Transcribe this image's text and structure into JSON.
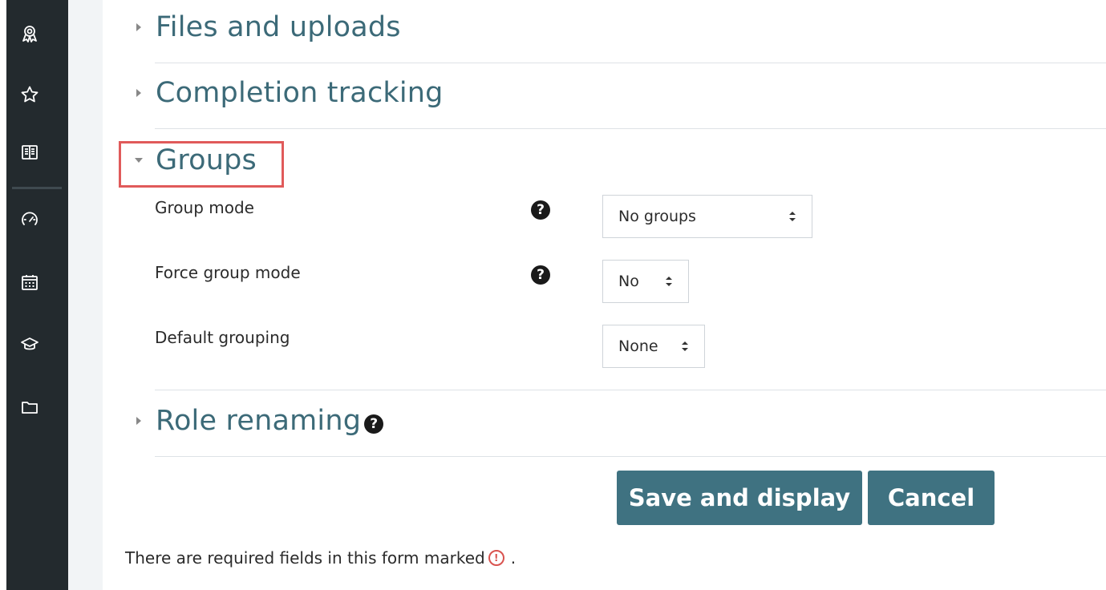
{
  "nav_rail": {
    "icons": [
      "badge-icon",
      "star-icon",
      "book-icon",
      "dashboard-icon",
      "calendar-icon",
      "graduation-cap-icon",
      "folder-icon"
    ]
  },
  "sections": {
    "files": {
      "title": "Files and uploads",
      "expanded": false
    },
    "completion": {
      "title": "Completion tracking",
      "expanded": false
    },
    "groups": {
      "title": "Groups",
      "expanded": true
    },
    "roles": {
      "title": "Role renaming",
      "expanded": false
    }
  },
  "groups_fields": {
    "group_mode": {
      "label": "Group mode",
      "value": "No groups"
    },
    "force_group_mode": {
      "label": "Force group mode",
      "value": "No"
    },
    "default_grouping": {
      "label": "Default grouping",
      "value": "None"
    }
  },
  "help_glyph": "?",
  "buttons": {
    "save": "Save and display",
    "cancel": "Cancel"
  },
  "footer": {
    "note_before": "There are required fields in this form marked",
    "required_glyph": "!",
    "note_after": "."
  },
  "colors": {
    "accent": "#3f7281",
    "heading": "#3c6a78",
    "rail": "#232a2e",
    "highlight": "#e05a5a",
    "required": "#d9534f"
  }
}
